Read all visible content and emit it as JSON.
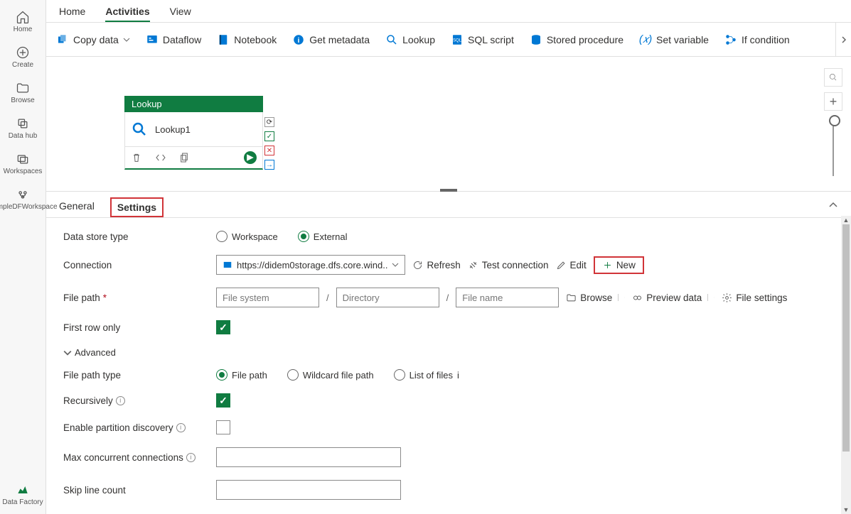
{
  "sidebar": {
    "items": [
      {
        "label": "Home"
      },
      {
        "label": "Create"
      },
      {
        "label": "Browse"
      },
      {
        "label": "Data hub"
      },
      {
        "label": "Workspaces"
      },
      {
        "label": "SampleDFWorkspace"
      }
    ],
    "bottom": {
      "label": "Data Factory"
    }
  },
  "toptabs": [
    "Home",
    "Activities",
    "View"
  ],
  "ribbon": [
    {
      "label": "Copy data"
    },
    {
      "label": "Dataflow"
    },
    {
      "label": "Notebook"
    },
    {
      "label": "Get metadata"
    },
    {
      "label": "Lookup"
    },
    {
      "label": "SQL script"
    },
    {
      "label": "Stored procedure"
    },
    {
      "label": "Set variable"
    },
    {
      "label": "If condition"
    }
  ],
  "activity": {
    "type": "Lookup",
    "name": "Lookup1"
  },
  "detailtabs": [
    "General",
    "Settings"
  ],
  "settings": {
    "dataStoreType": {
      "label": "Data store type",
      "option1": "Workspace",
      "option2": "External",
      "selected": "External"
    },
    "connection": {
      "label": "Connection",
      "value": "https://didem0storage.dfs.core.wind..",
      "actions": {
        "refresh": "Refresh",
        "test": "Test connection",
        "edit": "Edit",
        "new": "New"
      }
    },
    "filePath": {
      "label": "File path",
      "ph1": "File system",
      "ph2": "Directory",
      "ph3": "File name",
      "browse": "Browse",
      "preview": "Preview data",
      "fileSettings": "File settings"
    },
    "firstRowOnly": {
      "label": "First row only",
      "checked": true
    },
    "advanced": {
      "label": "Advanced"
    },
    "filePathType": {
      "label": "File path type",
      "opt1": "File path",
      "opt2": "Wildcard file path",
      "opt3": "List of files",
      "selected": "File path"
    },
    "recursively": {
      "label": "Recursively",
      "checked": true
    },
    "partitionDiscovery": {
      "label": "Enable partition discovery",
      "checked": false
    },
    "maxConcurrent": {
      "label": "Max concurrent connections"
    },
    "skipLineCount": {
      "label": "Skip line count"
    }
  }
}
